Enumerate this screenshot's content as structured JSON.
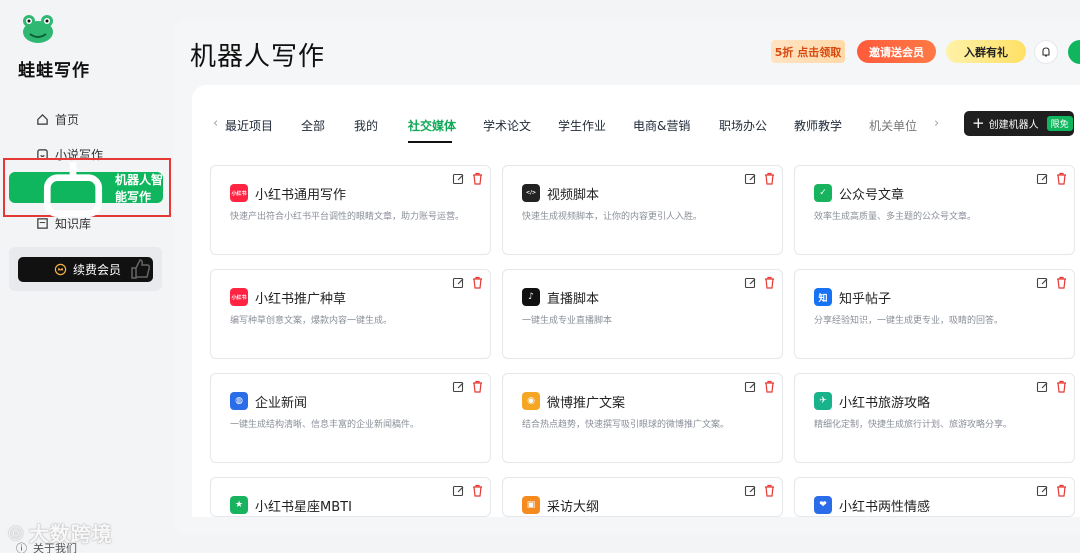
{
  "brand": "蛙蛙写作",
  "nav": {
    "home": "首页",
    "novel": "小说写作",
    "robot": "机器人智能写作",
    "knowledge": "知识库",
    "vip": "续费会员",
    "about": "关于我们"
  },
  "watermark": "大数跨境",
  "page_title": "机器人写作",
  "promos": {
    "p1": "5折 点击领取",
    "p2": "邀请送会员",
    "p3": "入群有礼"
  },
  "tabs": [
    "最近项目",
    "全部",
    "我的",
    "社交媒体",
    "学术论文",
    "学生作业",
    "电商&营销",
    "职场办公",
    "教师教学",
    "机关单位"
  ],
  "create_button": {
    "label": "创建机器人",
    "badge": "限免"
  },
  "cards": [
    {
      "title": "小红书通用写作",
      "desc": "快速产出符合小红书平台调性的眼睛文章，助力账号运营。",
      "icon_text": "小红书",
      "color": "#ff2442"
    },
    {
      "title": "视频脚本",
      "desc": "快速生成视频脚本，让你的内容更引人入胜。",
      "icon_text": "</>",
      "color": "#222222"
    },
    {
      "title": "公众号文章",
      "desc": "效率生成高质量、多主题的公众号文章。",
      "icon_text": "✓",
      "color": "#18b35f"
    },
    {
      "title": "小红书推广种草",
      "desc": "编写种草创意文案，爆款内容一键生成。",
      "icon_text": "小红书",
      "color": "#ff2442"
    },
    {
      "title": "直播脚本",
      "desc": "一键生成专业直播脚本",
      "icon_text": "♪",
      "color": "#111111"
    },
    {
      "title": "知乎帖子",
      "desc": "分享经验知识，一键生成更专业，吸睛的回答。",
      "icon_text": "知",
      "color": "#1772f6"
    },
    {
      "title": "企业新闻",
      "desc": "一键生成结构清晰、信息丰富的企业新闻稿件。",
      "icon_text": "◍",
      "color": "#2b6ce8"
    },
    {
      "title": "微博推广文案",
      "desc": "结合热点趋势，快速撰写吸引眼球的微博推广文案。",
      "icon_text": "◉",
      "color": "#f5a623"
    },
    {
      "title": "小红书旅游攻略",
      "desc": "精细化定制，快捷生成旅行计划、旅游攻略分享。",
      "icon_text": "✈",
      "color": "#18b38a"
    },
    {
      "title": "小红书星座MBTI",
      "desc": "",
      "icon_text": "★",
      "color": "#18b35f"
    },
    {
      "title": "采访大纲",
      "desc": "",
      "icon_text": "▣",
      "color": "#f58a1f"
    },
    {
      "title": "小红书两性情感",
      "desc": "",
      "icon_text": "❤",
      "color": "#2b6ce8"
    }
  ]
}
